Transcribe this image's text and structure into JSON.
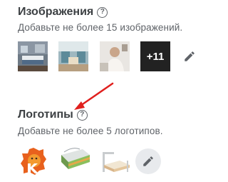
{
  "images_section": {
    "title": "Изображения",
    "hint": "Добавьте не более 15 изображений.",
    "more_count_label": "+11"
  },
  "logos_section": {
    "title": "Логотипы",
    "hint": "Добавьте не более 5 логотипов."
  },
  "colors": {
    "heading": "#3c4043",
    "hint": "#5f6368",
    "arrow": "#e0201e",
    "edit_icon": "#5f6368"
  },
  "icons": {
    "help": "help-circle-icon",
    "edit": "pencil-icon",
    "annotation": "red-arrow"
  }
}
